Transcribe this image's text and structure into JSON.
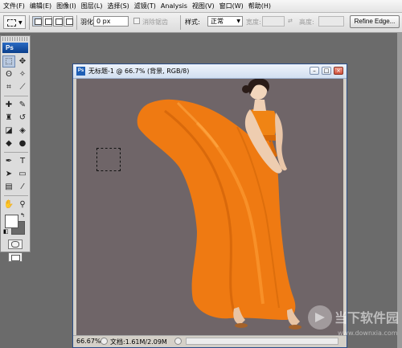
{
  "menu": [
    "文件(F)",
    "编辑(E)",
    "图像(I)",
    "图层(L)",
    "选择(S)",
    "滤镜(T)",
    "Analysis",
    "视图(V)",
    "窗口(W)",
    "帮助(H)"
  ],
  "options": {
    "feather_label": "羽化:",
    "feather_value": "0 px",
    "antialias_label": "消除锯齿",
    "style_label": "样式:",
    "style_value": "正常",
    "width_label": "宽度:",
    "height_label": "高度:",
    "refine_edge": "Refine Edge..."
  },
  "toolbox": {
    "app_label": "Ps",
    "tools": [
      {
        "name": "rect-marquee-tool",
        "glyph": "⬚"
      },
      {
        "name": "move-tool",
        "glyph": "✥"
      },
      {
        "name": "lasso-tool",
        "glyph": "ʘ"
      },
      {
        "name": "magic-wand-tool",
        "glyph": "✧"
      },
      {
        "name": "crop-tool",
        "glyph": "⌗"
      },
      {
        "name": "slice-tool",
        "glyph": "⟋"
      },
      {
        "name": "healing-brush-tool",
        "glyph": "✚"
      },
      {
        "name": "brush-tool",
        "glyph": "✎"
      },
      {
        "name": "clone-stamp-tool",
        "glyph": "♜"
      },
      {
        "name": "history-brush-tool",
        "glyph": "↺"
      },
      {
        "name": "eraser-tool",
        "glyph": "◪"
      },
      {
        "name": "paint-bucket-tool",
        "glyph": "◈"
      },
      {
        "name": "blur-tool",
        "glyph": "◆"
      },
      {
        "name": "dodge-tool",
        "glyph": "●"
      },
      {
        "name": "pen-tool",
        "glyph": "✒"
      },
      {
        "name": "type-tool",
        "glyph": "T"
      },
      {
        "name": "path-selection-tool",
        "glyph": "➤"
      },
      {
        "name": "shape-tool",
        "glyph": "▭"
      },
      {
        "name": "notes-tool",
        "glyph": "▤"
      },
      {
        "name": "eyedropper-tool",
        "glyph": "⁄"
      },
      {
        "name": "hand-tool",
        "glyph": "✋"
      },
      {
        "name": "zoom-tool",
        "glyph": "⚲"
      }
    ]
  },
  "document": {
    "title": "无标题-1 @ 66.7% (背景, RGB/8)",
    "zoom": "66.67%",
    "doc_size": "文档:1.61M/2.09M"
  },
  "colors": {
    "foreground": "#ffffff",
    "background": "#6a6a6a",
    "canvas": "#6f6568",
    "dress": "#f07a10"
  },
  "watermark": {
    "brand": "当下软件园",
    "url": "www.downxia.com"
  }
}
